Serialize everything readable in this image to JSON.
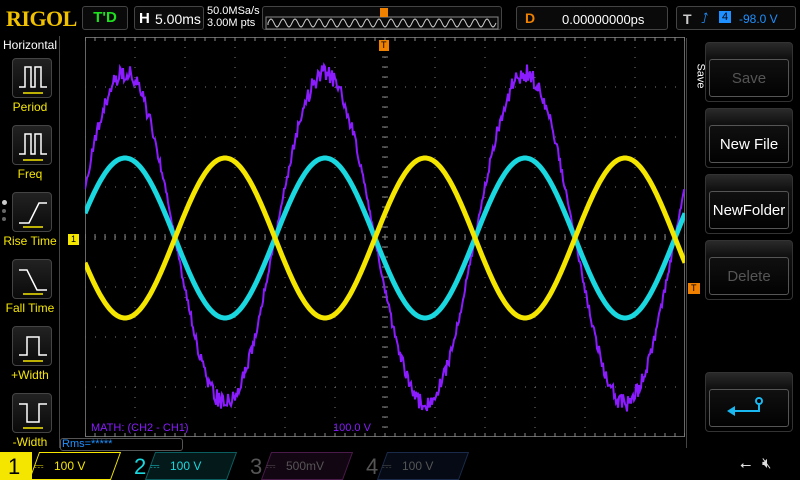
{
  "header": {
    "logo": "RIGOL",
    "trigger_status": "T'D",
    "h_label": "H",
    "timebase": "5.00ms",
    "sample_rate": "50.0MSa/s",
    "memory_depth": "3.00M pts",
    "delay_label": "D",
    "delay": "0.00000000ps",
    "trig_label": "T",
    "trig_source": "4",
    "trig_level": "-98.0 V"
  },
  "sidebar": {
    "title": "Horizontal",
    "items": [
      {
        "label": "Period",
        "icon": "period-icon"
      },
      {
        "label": "Freq",
        "icon": "freq-icon"
      },
      {
        "label": "Rise Time",
        "icon": "rise-time-icon"
      },
      {
        "label": "Fall Time",
        "icon": "fall-time-icon"
      },
      {
        "label": "+Width",
        "icon": "pos-width-icon"
      },
      {
        "label": "-Width",
        "icon": "neg-width-icon"
      }
    ]
  },
  "menu": {
    "title": "Save",
    "buttons": [
      {
        "label": "Save",
        "enabled": false
      },
      {
        "label": "New File",
        "enabled": true
      },
      {
        "label": "NewFolder",
        "enabled": true
      },
      {
        "label": "Delete",
        "enabled": false
      }
    ],
    "back_icon": "return-icon"
  },
  "screen": {
    "math_label": "MATH: (CH2 - CH1)",
    "math_scale": "100.0 V",
    "ch1_marker": "1",
    "trig_marker": "T",
    "rms": "Rms=*****"
  },
  "channels": [
    {
      "num": "1",
      "scale": "100 V",
      "color": "#f5e600"
    },
    {
      "num": "2",
      "scale": "100 V",
      "color": "#19d8e0"
    },
    {
      "num": "3",
      "scale": "500mV",
      "color": "#555555"
    },
    {
      "num": "4",
      "scale": "100 V",
      "color": "#555555"
    }
  ],
  "waveforms": {
    "volts_per_div": 100,
    "ms_per_div": 5,
    "period_ms": 20,
    "ch1_amplitude_v": 160,
    "ch2_amplitude_v": 160,
    "math_amplitude_v": 330,
    "colors": {
      "ch1": "#f5e600",
      "ch2": "#19d8e0",
      "math": "#8a1cff"
    }
  }
}
